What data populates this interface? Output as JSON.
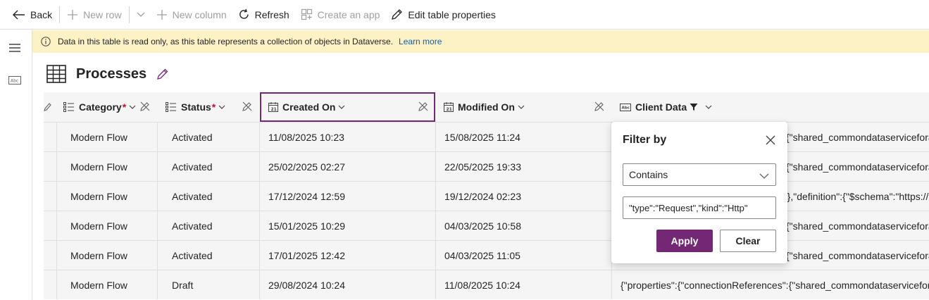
{
  "toolbar": {
    "back_label": "Back",
    "new_row_label": "New row",
    "new_column_label": "New column",
    "refresh_label": "Refresh",
    "create_app_label": "Create an app",
    "edit_table_label": "Edit table properties"
  },
  "banner": {
    "message": "Data in this table is read only, as this table represents a collection of objects in Dataverse.",
    "link": "Learn more"
  },
  "page": {
    "title": "Processes"
  },
  "grid": {
    "columns": [
      {
        "label": "Category",
        "required": "*",
        "icon": "choice-icon"
      },
      {
        "label": "Status",
        "required": "*",
        "icon": "choice-icon"
      },
      {
        "label": "Created On",
        "icon": "calendar-icon"
      },
      {
        "label": "Modified On",
        "icon": "calendar-icon"
      },
      {
        "label": "Client Data",
        "icon": "text-field-icon",
        "filtered": true
      }
    ],
    "rows": [
      {
        "category": "Modern Flow",
        "status": "Activated",
        "created": "11/08/2025 10:23",
        "modified": "15/08/2025 11:24",
        "client": "{\"shared_commondataserviceforapps\""
      },
      {
        "category": "Modern Flow",
        "status": "Activated",
        "created": "25/02/2025 02:27",
        "modified": "22/05/2025 19:33",
        "client": "{\"shared_commondataserviceforapps\""
      },
      {
        "category": "Modern Flow",
        "status": "Activated",
        "created": "17/12/2024 12:59",
        "modified": "19/12/2024 02:23",
        "client": "}},\"definition\":{\"$schema\":\"https://"
      },
      {
        "category": "Modern Flow",
        "status": "Activated",
        "created": "15/01/2025 10:29",
        "modified": "04/03/2025 10:58",
        "client": "{\"shared_commondataserviceforapps\""
      },
      {
        "category": "Modern Flow",
        "status": "Activated",
        "created": "17/01/2025 12:42",
        "modified": "04/03/2025 11:05",
        "client": "{\"shared_commondataserviceforapps\""
      },
      {
        "category": "Modern Flow",
        "status": "Draft",
        "created": "29/08/2024 10:24",
        "modified": "11/08/2025 10:24",
        "client": "{\"properties\":{\"connectionReferences\":{\"shared_commondataserviceforapps\""
      }
    ]
  },
  "filter": {
    "title": "Filter by",
    "operator": "Contains",
    "value": "\"type\":\"Request\",\"kind\":\"Http\"",
    "apply_label": "Apply",
    "clear_label": "Clear"
  },
  "colors": {
    "accent": "#742774",
    "banner_bg": "#fdf1c6",
    "link": "#115ea3",
    "required": "#c50f1f"
  }
}
